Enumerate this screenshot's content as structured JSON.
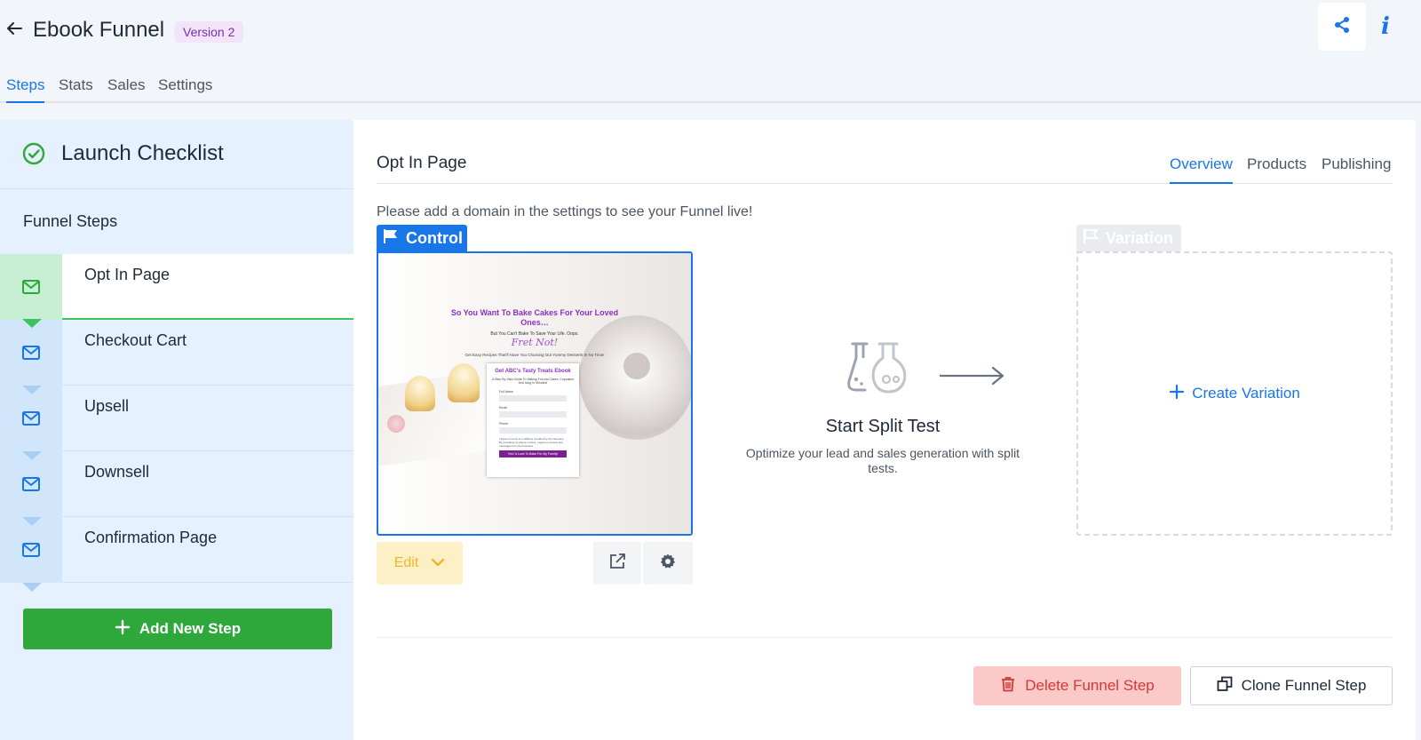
{
  "header": {
    "title": "Ebook Funnel",
    "version_badge": "Version 2"
  },
  "top_tabs": [
    {
      "label": "Steps",
      "active": true
    },
    {
      "label": "Stats",
      "active": false
    },
    {
      "label": "Sales",
      "active": false
    },
    {
      "label": "Settings",
      "active": false
    }
  ],
  "sidebar": {
    "launch_title": "Launch Checklist",
    "steps_label": "Funnel Steps",
    "steps": [
      {
        "label": "Opt In Page",
        "active": true
      },
      {
        "label": "Checkout Cart",
        "active": false
      },
      {
        "label": "Upsell",
        "active": false
      },
      {
        "label": "Downsell",
        "active": false
      },
      {
        "label": "Confirmation Page",
        "active": false
      }
    ],
    "add_step_label": "Add New Step"
  },
  "main": {
    "title": "Opt In Page",
    "tabs": [
      {
        "label": "Overview",
        "active": true
      },
      {
        "label": "Products",
        "active": false
      },
      {
        "label": "Publishing",
        "active": false
      }
    ],
    "notice": "Please add a domain in the settings to see your Funnel live!",
    "control_label": "Control",
    "variation_label": "Variation",
    "edit_label": "Edit",
    "create_variation_label": "Create Variation",
    "split_title": "Start Split Test",
    "split_desc": "Optimize your lead and sales generation with split tests.",
    "delete_label": "Delete Funnel Step",
    "clone_label": "Clone Funnel Step"
  },
  "preview": {
    "headline": "So You Want To Bake Cakes For Your Loved Ones…",
    "sub": "But You Can't Bake To Save Your Life. Oops.",
    "script": "Fret Not!",
    "line": "Get Easy Recipes That'll Have You Churning Out Yummy Desserts In No Time!",
    "form_title": "Get ABC's Tasty Treats Ebook",
    "form_sub": "A Step By Step Guide To Making Fun-est Cakes, Cupcakes And Icing In Minutes!",
    "field1": "Full Name",
    "field2": "Email",
    "field3": "Phone",
    "consent": "I agree to terms & conditions provided by the company. By providing my phone number, I agree to receive text messages from the business.",
    "submit": "Yes I'd Love To Bake For My Family!"
  },
  "colors": {
    "accent": "#1976e8",
    "success": "#2ea83a",
    "danger": "#d33838",
    "warning": "#f0b42a",
    "badge_text": "#7b2ea8"
  }
}
